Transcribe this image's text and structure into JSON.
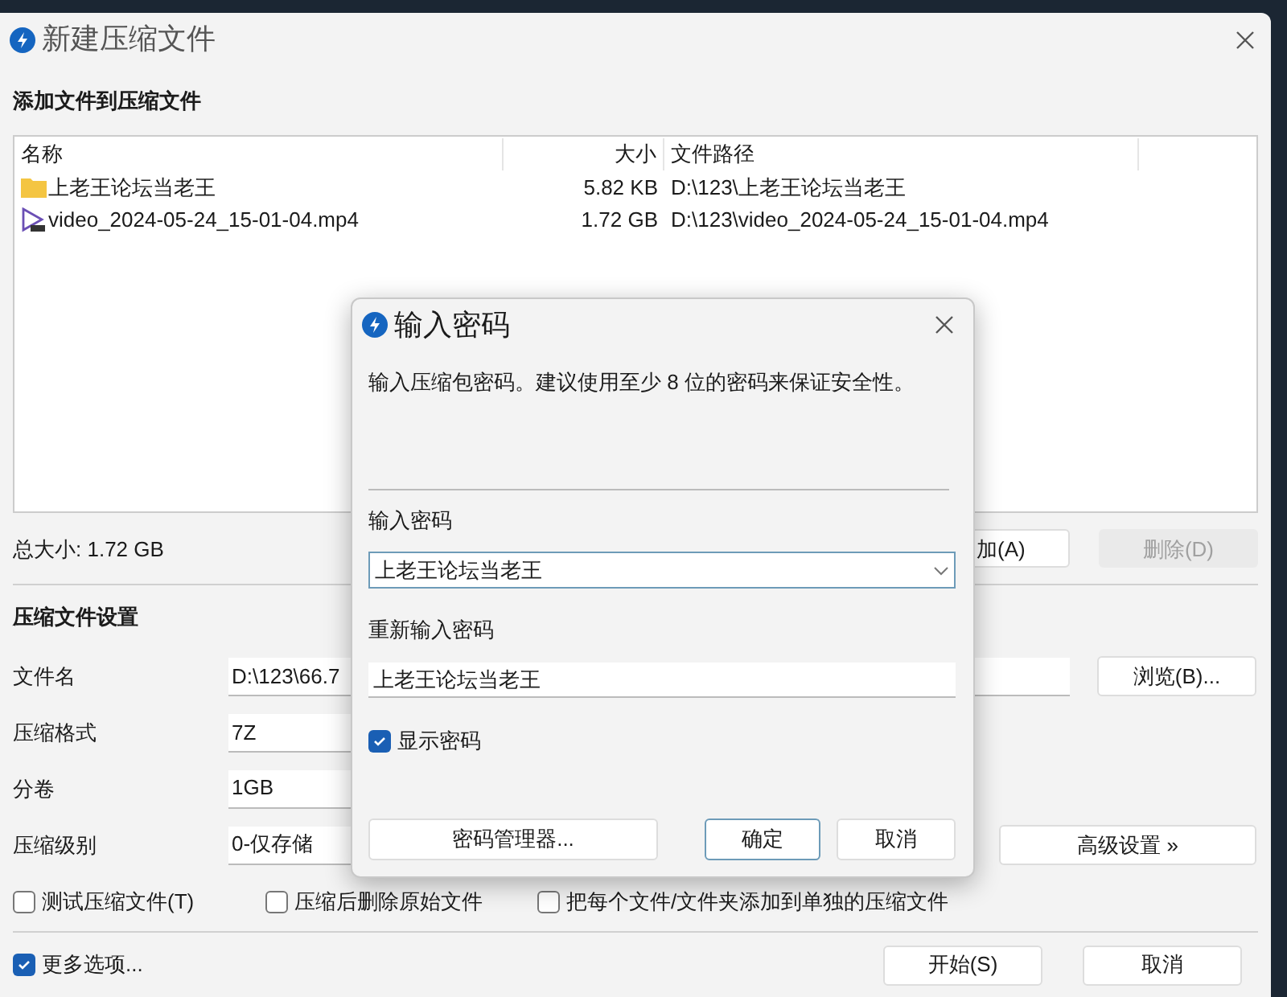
{
  "window": {
    "title": "新建压缩文件"
  },
  "files": {
    "heading": "添加文件到压缩文件",
    "columns": [
      "名称",
      "大小",
      "文件路径"
    ],
    "rows": [
      {
        "kind": "folder",
        "name": "上老王论坛当老王",
        "size": "5.82 KB",
        "path": "D:\\123\\上老王论坛当老王"
      },
      {
        "kind": "video",
        "name": "video_2024-05-24_15-01-04.mp4",
        "size": "1.72 GB",
        "path": "D:\\123\\video_2024-05-24_15-01-04.mp4"
      }
    ]
  },
  "total_size": "总大小: 1.72 GB",
  "file_buttons": [
    {
      "label": "加(A)",
      "disabled": false
    },
    {
      "label": "删除(D)",
      "disabled": true
    }
  ],
  "settings": {
    "heading": "压缩文件设置",
    "fields": [
      {
        "kind": "path",
        "label": "文件名",
        "value": "D:\\123\\66.7"
      },
      {
        "kind": "combo",
        "label": "压缩格式",
        "value": "7Z"
      },
      {
        "kind": "combo",
        "label": "分卷",
        "value": "1GB"
      },
      {
        "kind": "level",
        "label": "压缩级别",
        "value": "0-仅存储"
      }
    ],
    "browse_button": "浏览(B)...",
    "advanced_button": "高级设置 »"
  },
  "options": [
    {
      "label": "测试压缩文件(T)",
      "checked": false
    },
    {
      "label": "压缩后删除原始文件",
      "checked": false
    },
    {
      "label": "把每个文件/文件夹添加到单独的压缩文件",
      "checked": false
    }
  ],
  "more_options": {
    "label": "更多选项...",
    "checked": true
  },
  "buttons": [
    {
      "label": "开始(S)"
    },
    {
      "label": "取消"
    }
  ],
  "password_dialog": {
    "title": "输入密码",
    "description": "输入压缩包密码。建议使用至少 8 位的密码来保证安全性。",
    "password_label": "输入密码",
    "password_value": "上老王论坛当老王",
    "repeat_label": "重新输入密码",
    "repeat_value": "上老王论坛当老王",
    "show_password": {
      "label": "显示密码",
      "checked": true
    },
    "buttons": [
      {
        "kind": "manager",
        "label": "密码管理器..."
      },
      {
        "kind": "default",
        "label": "确定"
      },
      {
        "kind": "normal",
        "label": "取消"
      }
    ]
  }
}
